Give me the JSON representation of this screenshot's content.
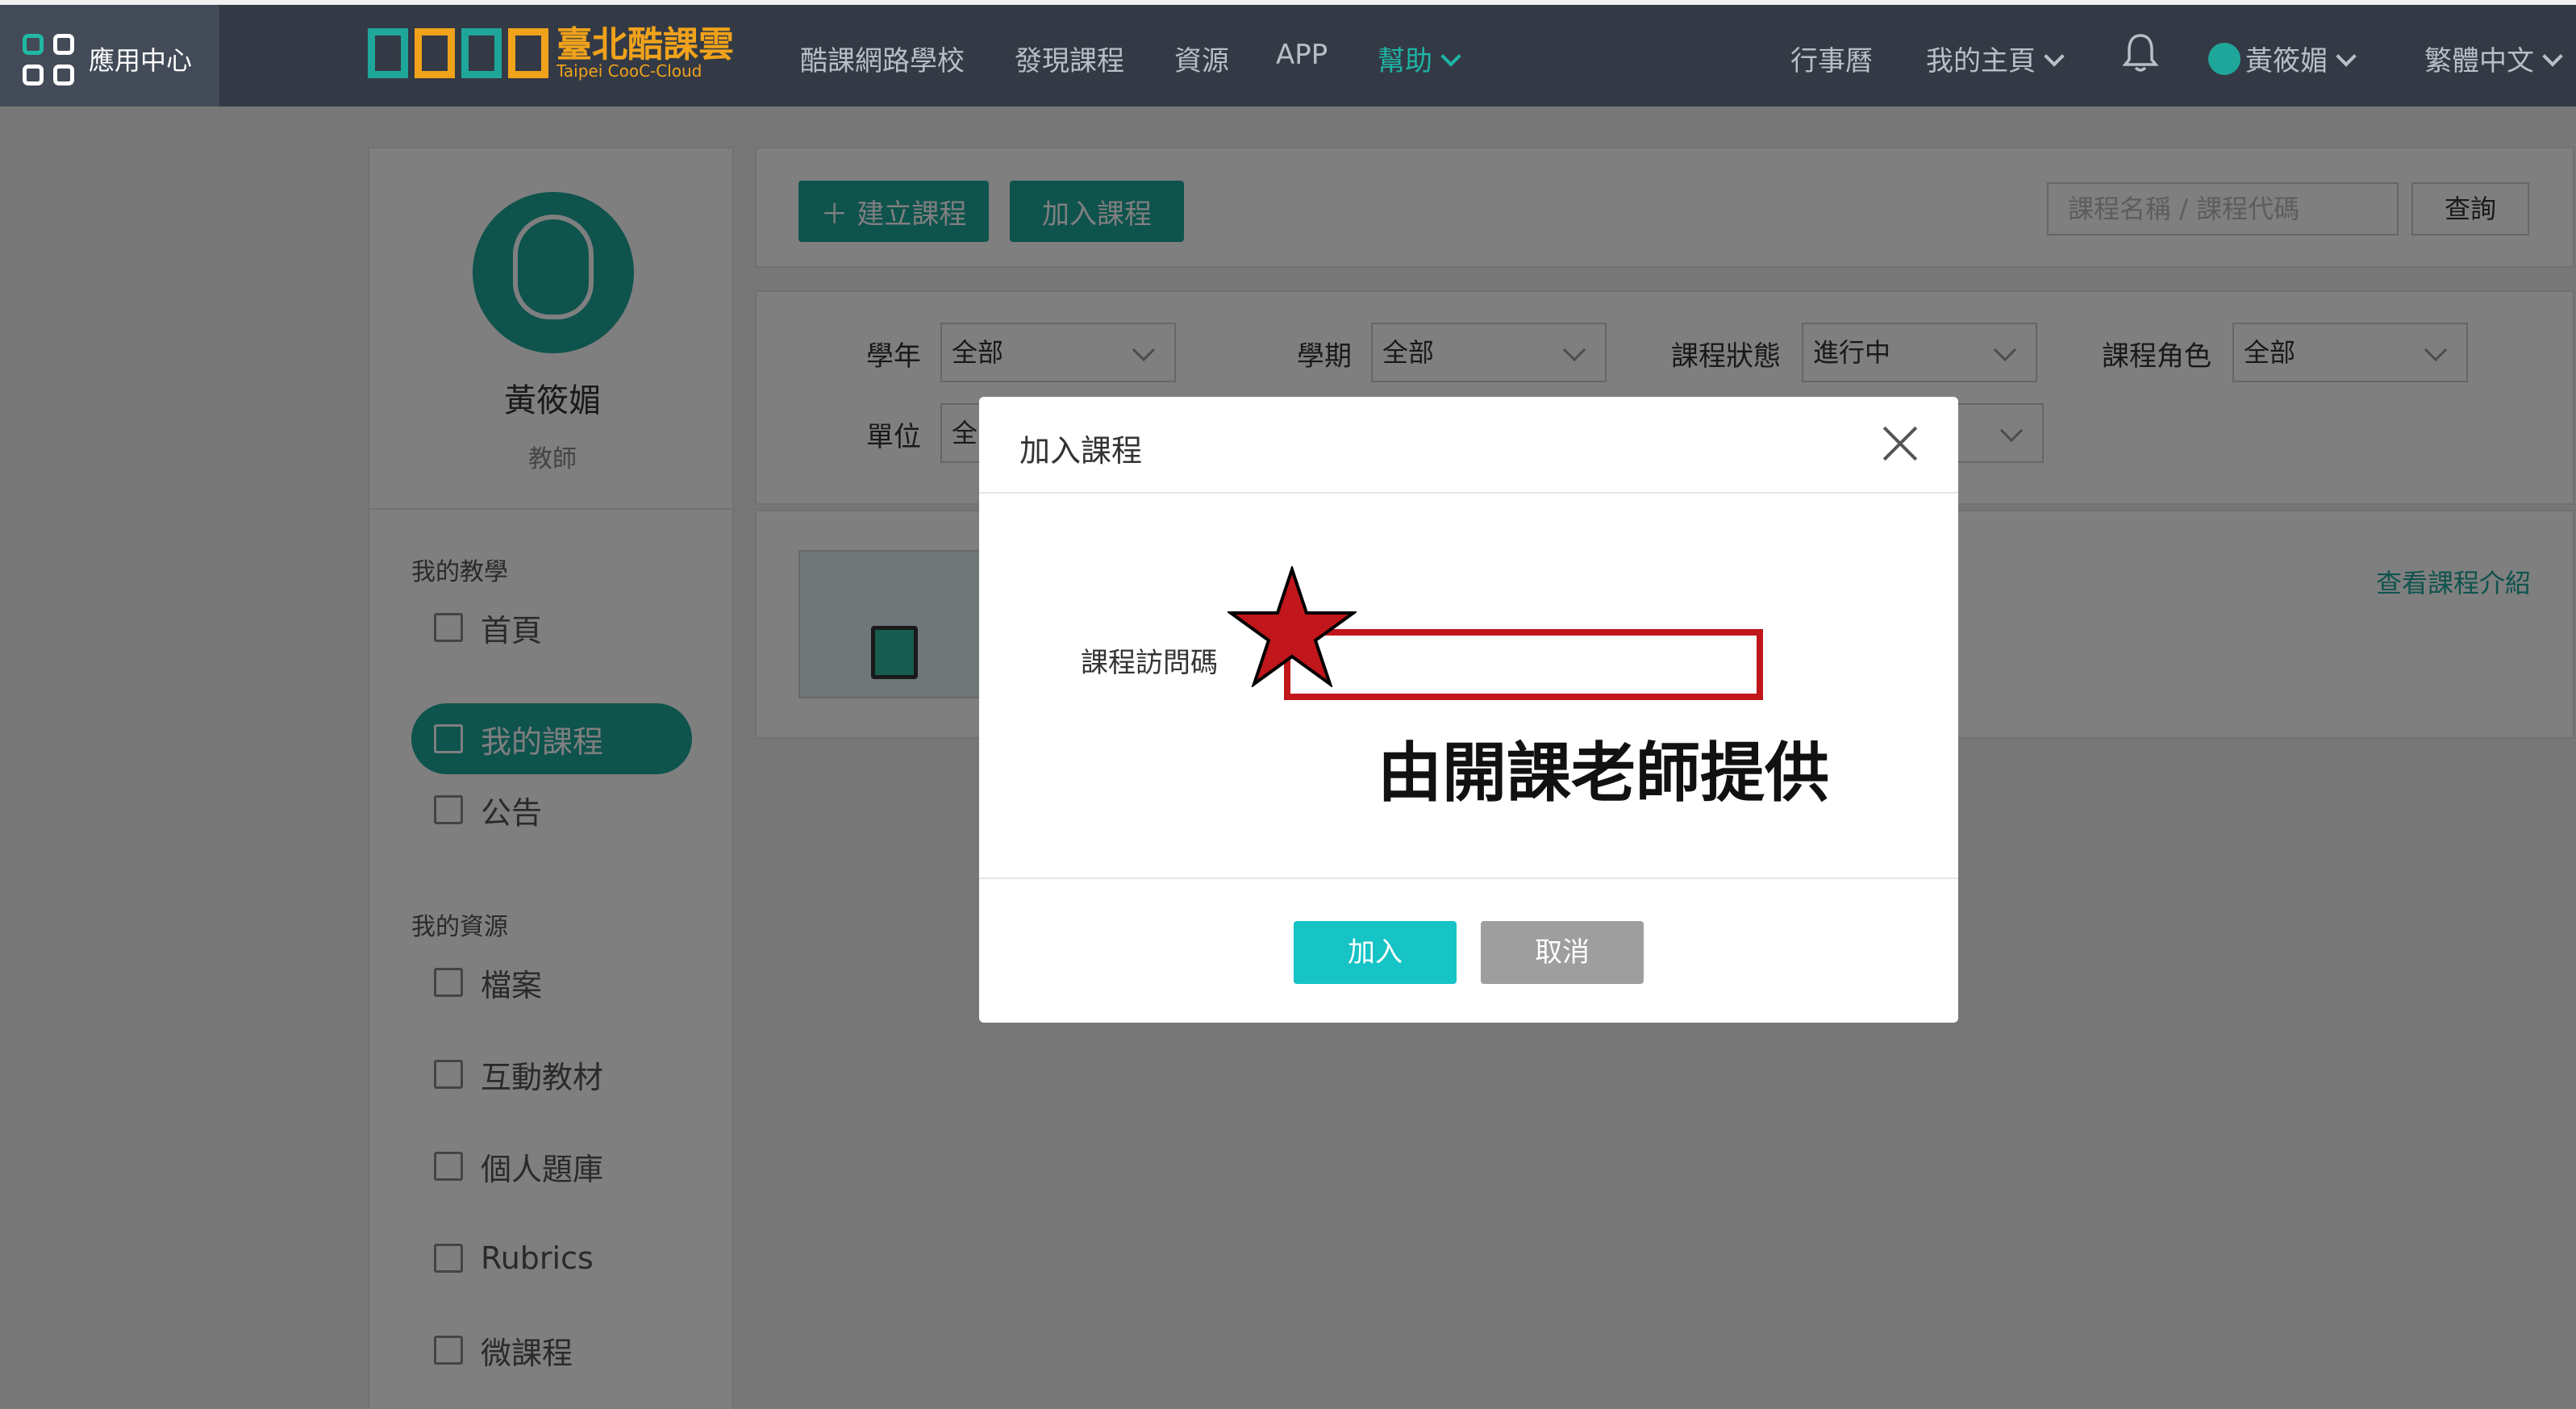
{
  "app_center": {
    "label": "應用中心"
  },
  "logo": {
    "title": "臺北酷課雲",
    "subtitle": "Taipei CooC-Cloud"
  },
  "nav": {
    "school": "酷課網路學校",
    "discover": "發現課程",
    "resources": "資源",
    "app": "APP",
    "help": "幫助",
    "calendar": "行事曆",
    "homepage": "我的主頁",
    "user": "黃筱媚",
    "language": "繁體中文"
  },
  "profile": {
    "name": "黃筱媚",
    "role": "教師"
  },
  "sidebar": {
    "section_teaching": "我的教學",
    "section_resources": "我的資源",
    "items": [
      {
        "label": "首頁"
      },
      {
        "label": "我的課程"
      },
      {
        "label": "公告"
      },
      {
        "label": "檔案"
      },
      {
        "label": "互動教材"
      },
      {
        "label": "個人題庫"
      },
      {
        "label": "Rubrics"
      },
      {
        "label": "微課程"
      }
    ]
  },
  "toolbar": {
    "create_label": "＋ 建立課程",
    "join_label": "加入課程",
    "search_placeholder": "課程名稱 / 課程代碼",
    "search_button": "查詢"
  },
  "filters": {
    "year_label": "學年",
    "year_value": "全部",
    "term_label": "學期",
    "term_value": "全部",
    "status_label": "課程狀態",
    "status_value": "進行中",
    "role_label": "課程角色",
    "role_value": "全部",
    "unit_label": "單位",
    "unit_value": "全"
  },
  "course": {
    "view_intro": "查看課程介紹"
  },
  "modal": {
    "title": "加入課程",
    "field_label": "課程訪問碼",
    "hint": "由開課老師提供",
    "ok_label": "加入",
    "cancel_label": "取消"
  },
  "colors": {
    "accent": "#1fa69a",
    "topbar": "#333a45",
    "highlight": "#c0161c"
  }
}
